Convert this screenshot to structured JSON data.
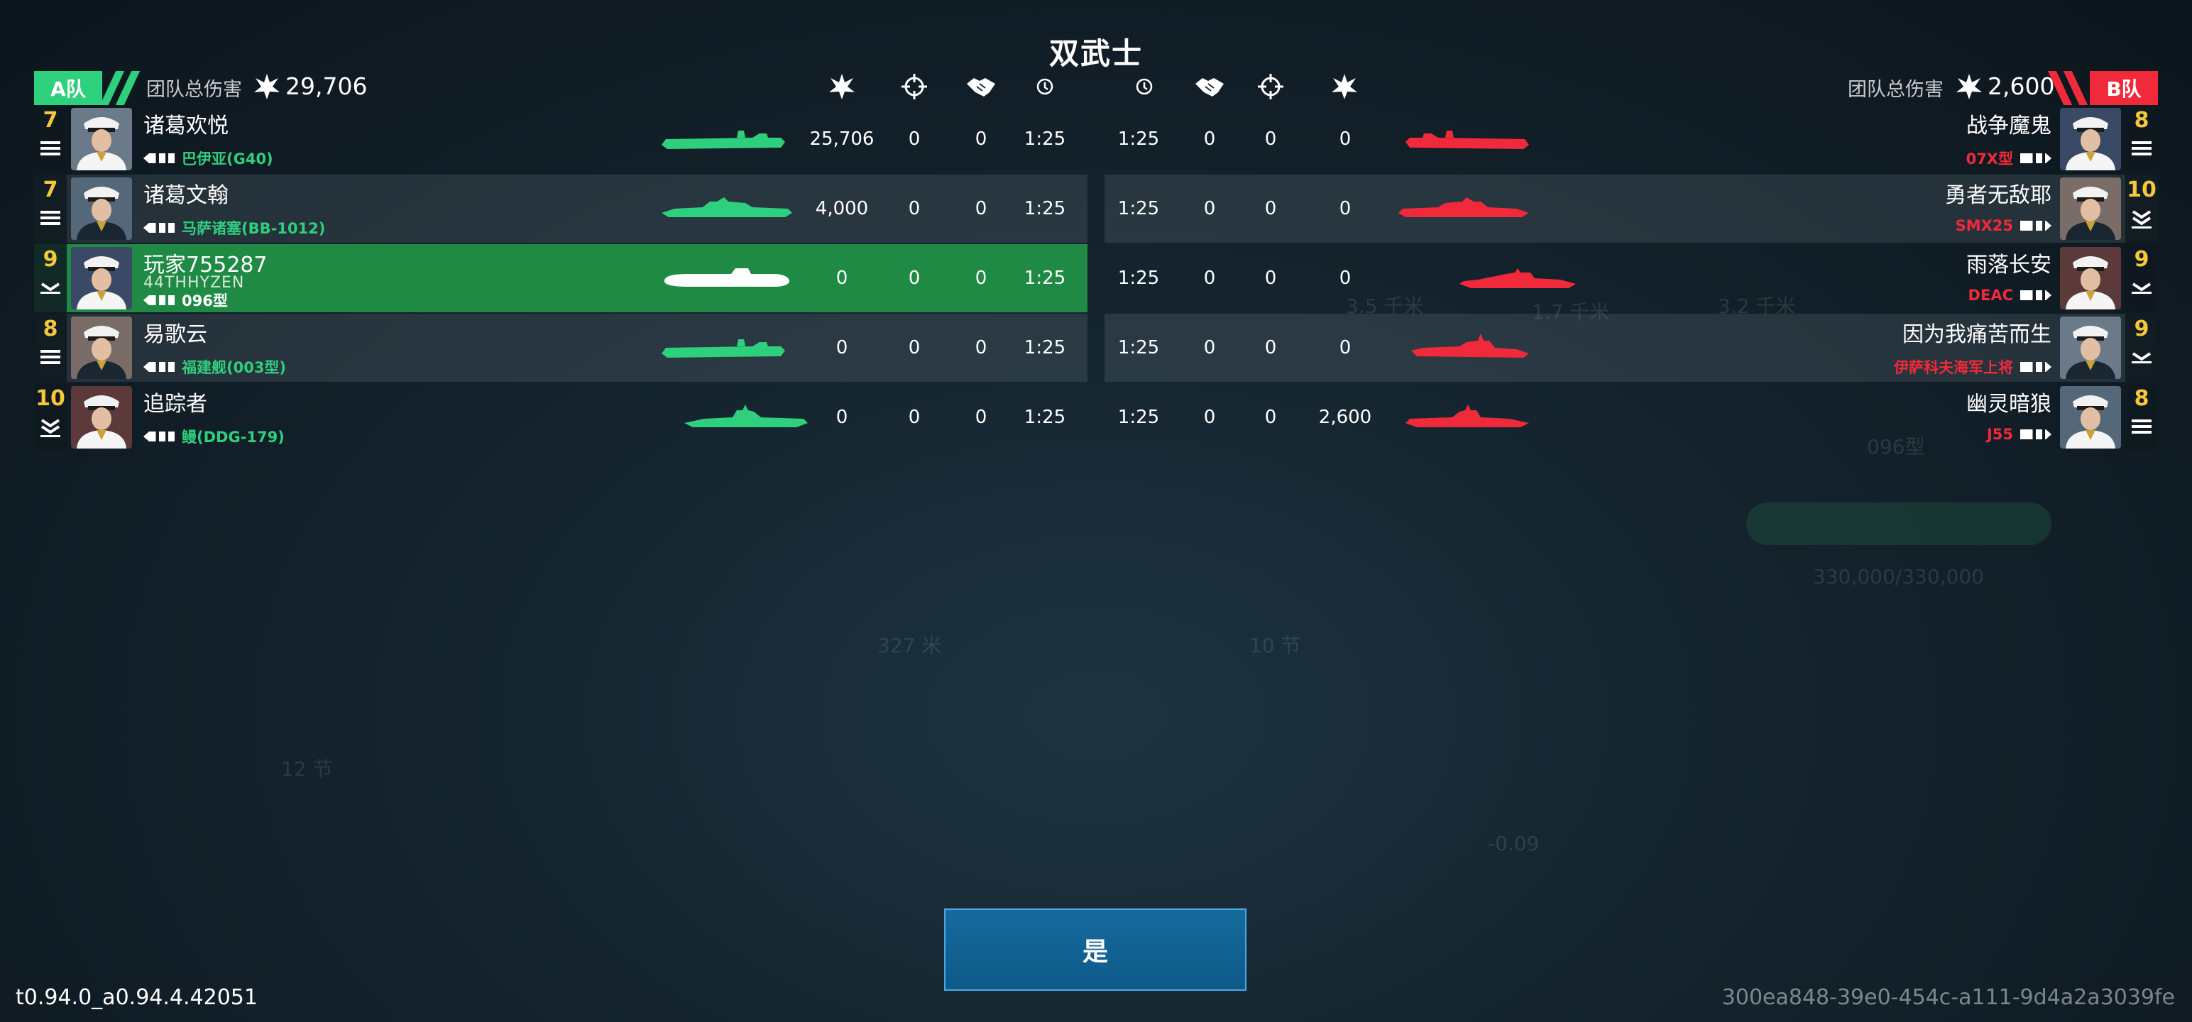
{
  "title": "双武士",
  "confirm_label": "是",
  "version": "t0.94.0_a0.94.4.42051",
  "session_id": "300ea848-39e0-454c-a111-9d4a2a3039fe",
  "colors": {
    "team_a": "#2ecf7d",
    "team_b": "#f02a3a",
    "rank": "#f5c73a",
    "highlight": "#1f8a44"
  },
  "header_icons": [
    "damage-icon",
    "crosshair-icon",
    "handshake-icon",
    "clock-icon"
  ],
  "team_a": {
    "label": "A队",
    "total_label": "团队总伤害",
    "total_damage": "29,706",
    "players": [
      {
        "level": "7",
        "insignia": "three-bars",
        "name": "诸葛欢悦",
        "clan": "",
        "ship": "巴伊亚(G40)",
        "ship_type": "carrier",
        "damage": "25,706",
        "kills": "0",
        "assists": "0",
        "time": "1:25",
        "row_style": ""
      },
      {
        "level": "7",
        "insignia": "three-bars",
        "name": "诸葛文翰",
        "clan": "",
        "ship": "马萨诸塞(BB-1012)",
        "ship_type": "battleship",
        "damage": "4,000",
        "kills": "0",
        "assists": "0",
        "time": "1:25",
        "row_style": "alt"
      },
      {
        "level": "9",
        "insignia": "chevron",
        "name": "玩家755287",
        "clan": "44THHYZEN",
        "ship": "096型",
        "ship_type": "submarine",
        "damage": "0",
        "kills": "0",
        "assists": "0",
        "time": "1:25",
        "row_style": "hl"
      },
      {
        "level": "8",
        "insignia": "three-bars",
        "name": "易歌云",
        "clan": "",
        "ship": "福建舰(003型)",
        "ship_type": "carrier",
        "damage": "0",
        "kills": "0",
        "assists": "0",
        "time": "1:25",
        "row_style": "alt"
      },
      {
        "level": "10",
        "insignia": "double-chevron",
        "name": "追踪者",
        "clan": "",
        "ship": "鳗(DDG-179)",
        "ship_type": "destroyer",
        "damage": "0",
        "kills": "0",
        "assists": "0",
        "time": "1:25",
        "row_style": ""
      }
    ]
  },
  "team_b": {
    "label": "B队",
    "total_label": "团队总伤害",
    "total_damage": "2,600",
    "players": [
      {
        "level": "8",
        "insignia": "three-bars",
        "name": "战争魔鬼",
        "ship": "07X型",
        "ship_type": "carrier",
        "damage": "0",
        "kills": "0",
        "assists": "0",
        "time": "1:25",
        "row_style": ""
      },
      {
        "level": "10",
        "insignia": "double-chevron",
        "name": "勇者无敌耶",
        "ship": "SMX25",
        "ship_type": "battleship",
        "damage": "0",
        "kills": "0",
        "assists": "0",
        "time": "1:25",
        "row_style": "alt"
      },
      {
        "level": "9",
        "insignia": "chevron",
        "name": "雨落长安",
        "ship": "DEAC",
        "ship_type": "frigate",
        "damage": "0",
        "kills": "0",
        "assists": "0",
        "time": "1:25",
        "row_style": ""
      },
      {
        "level": "9",
        "insignia": "chevron",
        "name": "因为我痛苦而生",
        "ship": "伊萨科夫海军上将",
        "ship_type": "cruiser",
        "damage": "0",
        "kills": "0",
        "assists": "0",
        "time": "1:25",
        "row_style": "alt"
      },
      {
        "level": "8",
        "insignia": "three-bars",
        "name": "幽灵暗狼",
        "ship": "J55",
        "ship_type": "destroyer",
        "damage": "2,600",
        "kills": "0",
        "assists": "0",
        "time": "1:25",
        "row_style": ""
      }
    ]
  },
  "background_hud": [
    "327 米",
    "10 节",
    "12 节",
    "096型",
    "330,000/330,000",
    "3.5 千米",
    "1.7 千米",
    "3.2 千米",
    "-0.09"
  ]
}
